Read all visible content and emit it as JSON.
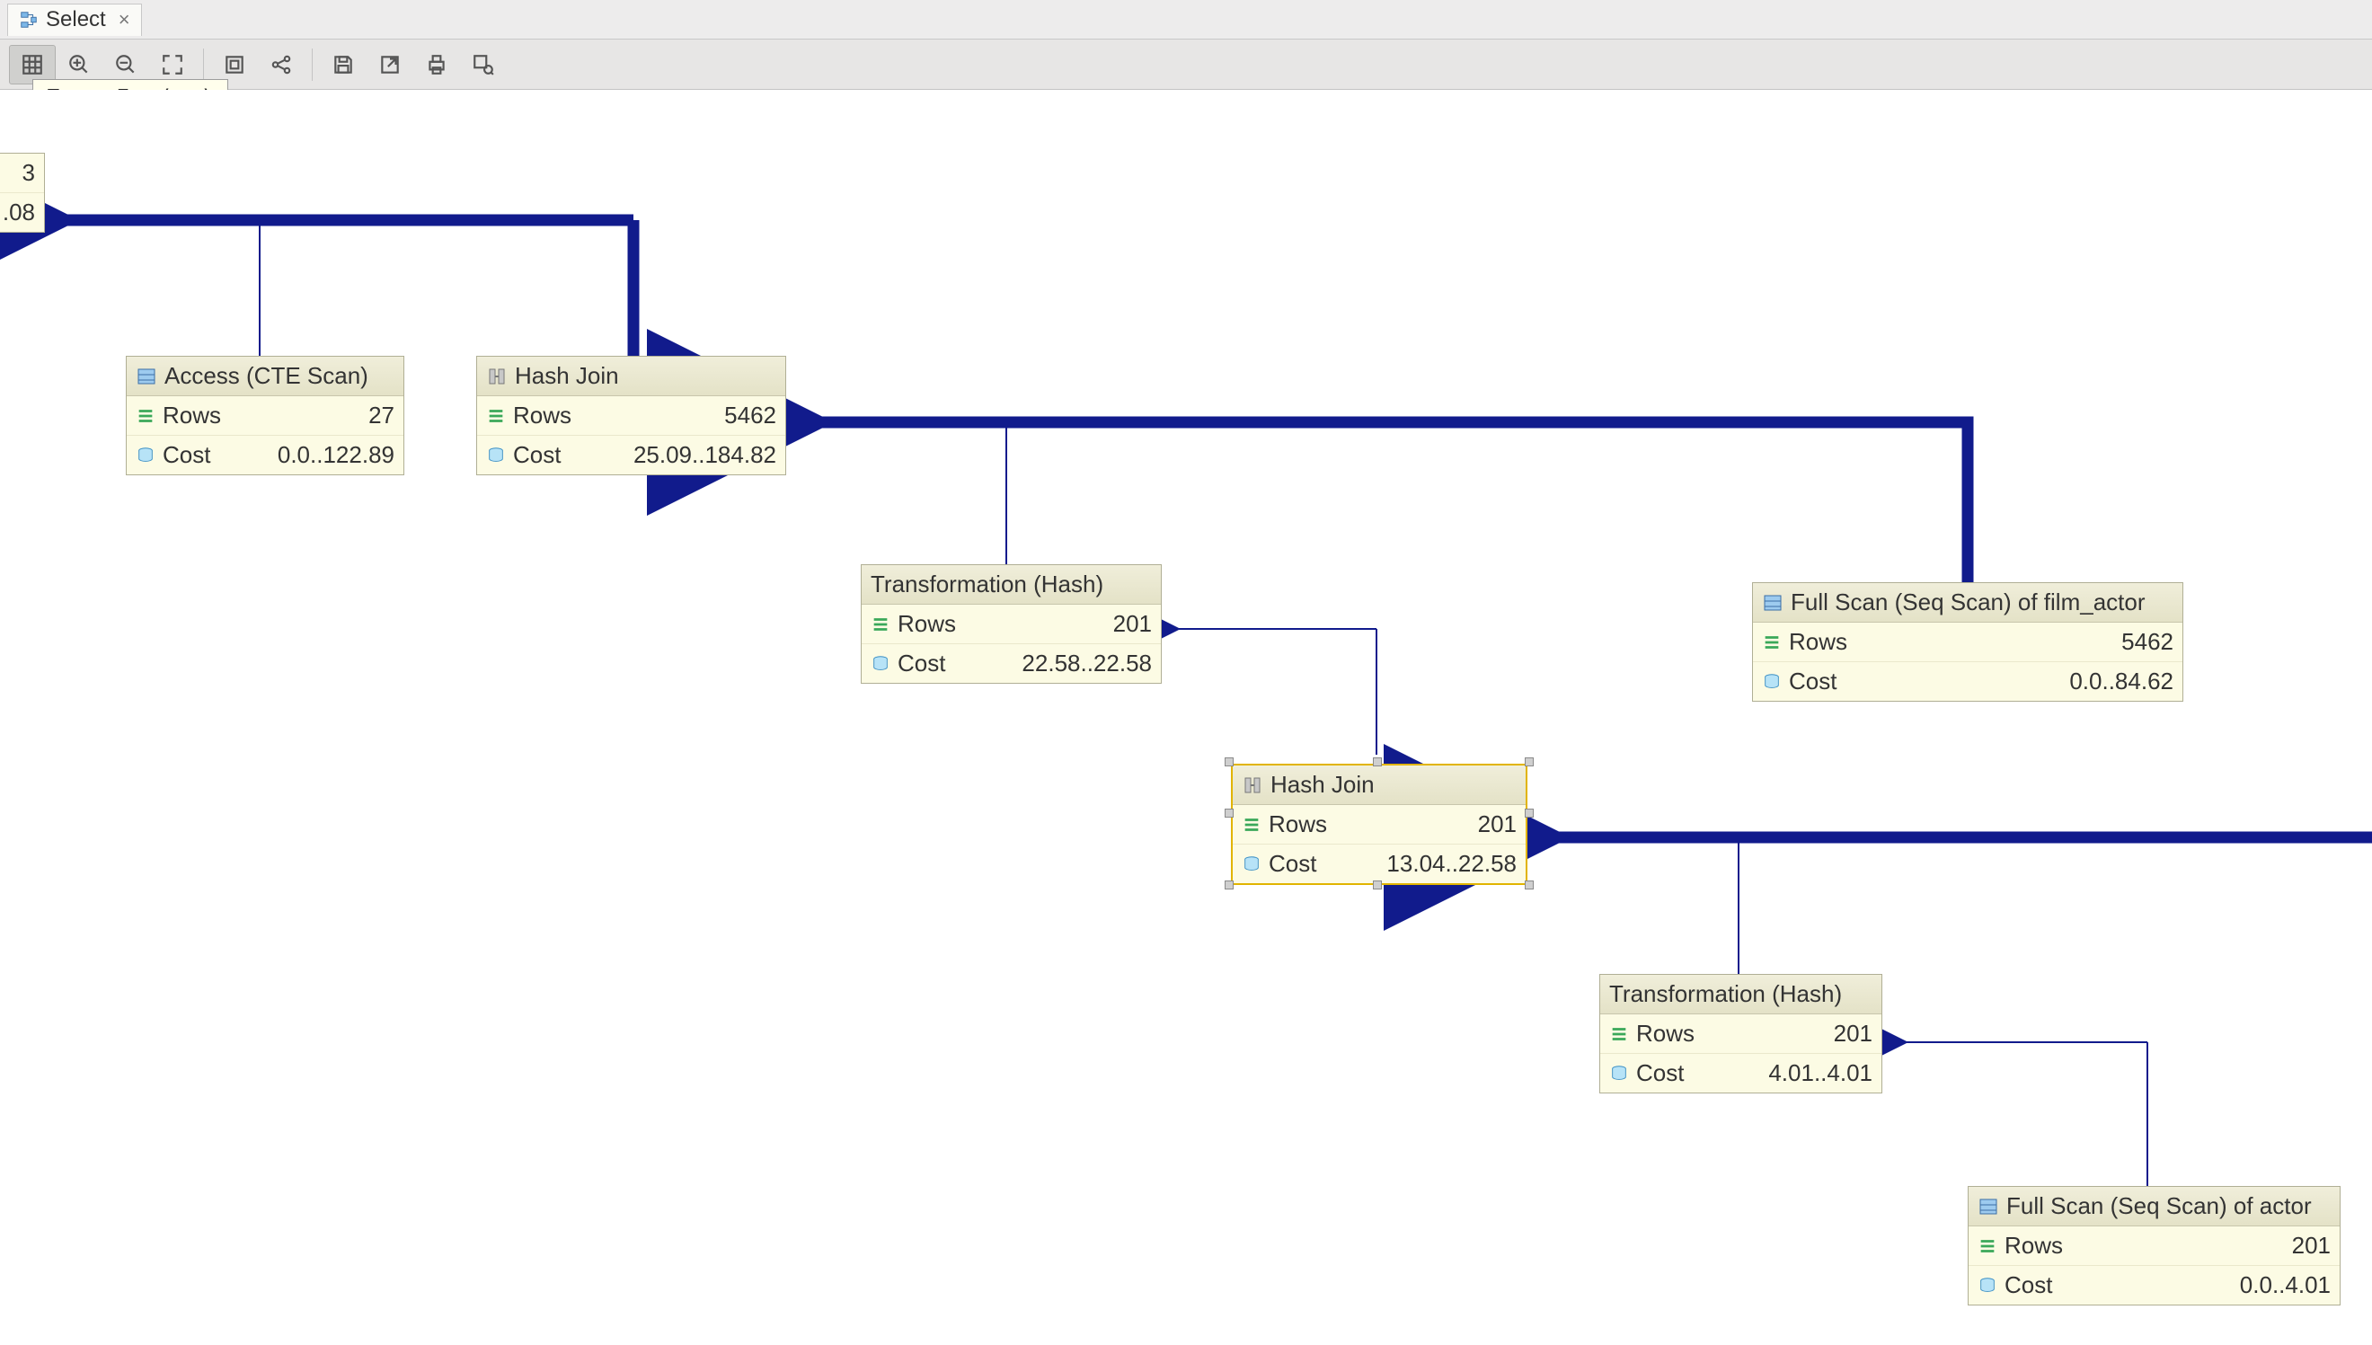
{
  "tab": {
    "label": "Select"
  },
  "tooltip": {
    "text": "Zoom In (⌘+)"
  },
  "toolbar": {
    "items": [
      {
        "name": "grid-view-icon"
      },
      {
        "name": "zoom-in-icon"
      },
      {
        "name": "zoom-out-icon"
      },
      {
        "name": "zoom-fit-icon"
      },
      {
        "name": "fit-page-icon"
      },
      {
        "name": "share-icon"
      },
      {
        "name": "save-icon"
      },
      {
        "name": "export-icon"
      },
      {
        "name": "print-icon"
      },
      {
        "name": "inspect-icon"
      }
    ]
  },
  "nodes": {
    "root": {
      "rows_value": "3",
      "cost_value": ".08"
    },
    "access_cte": {
      "title": "Access (CTE Scan)",
      "rows_label": "Rows",
      "rows_value": "27",
      "cost_label": "Cost",
      "cost_value": "0.0..122.89"
    },
    "hash_join_1": {
      "title": "Hash Join",
      "rows_label": "Rows",
      "rows_value": "5462",
      "cost_label": "Cost",
      "cost_value": "25.09..184.82"
    },
    "transform_1": {
      "title": "Transformation (Hash)",
      "rows_label": "Rows",
      "rows_value": "201",
      "cost_label": "Cost",
      "cost_value": "22.58..22.58"
    },
    "seq_film_actor": {
      "title": "Full Scan (Seq Scan) of film_actor",
      "rows_label": "Rows",
      "rows_value": "5462",
      "cost_label": "Cost",
      "cost_value": "0.0..84.62"
    },
    "hash_join_2": {
      "title": "Hash Join",
      "rows_label": "Rows",
      "rows_value": "201",
      "cost_label": "Cost",
      "cost_value": "13.04..22.58"
    },
    "transform_2": {
      "title": "Transformation (Hash)",
      "rows_label": "Rows",
      "rows_value": "201",
      "cost_label": "Cost",
      "cost_value": "4.01..4.01"
    },
    "seq_actor": {
      "title": "Full Scan (Seq Scan) of actor",
      "rows_label": "Rows",
      "rows_value": "201",
      "cost_label": "Cost",
      "cost_value": "0.0..4.01"
    }
  },
  "colors": {
    "edge": "#111b8c",
    "node_bg": "#fcfbe4",
    "node_border": "#b0af95",
    "selected_border": "#e1b400"
  }
}
